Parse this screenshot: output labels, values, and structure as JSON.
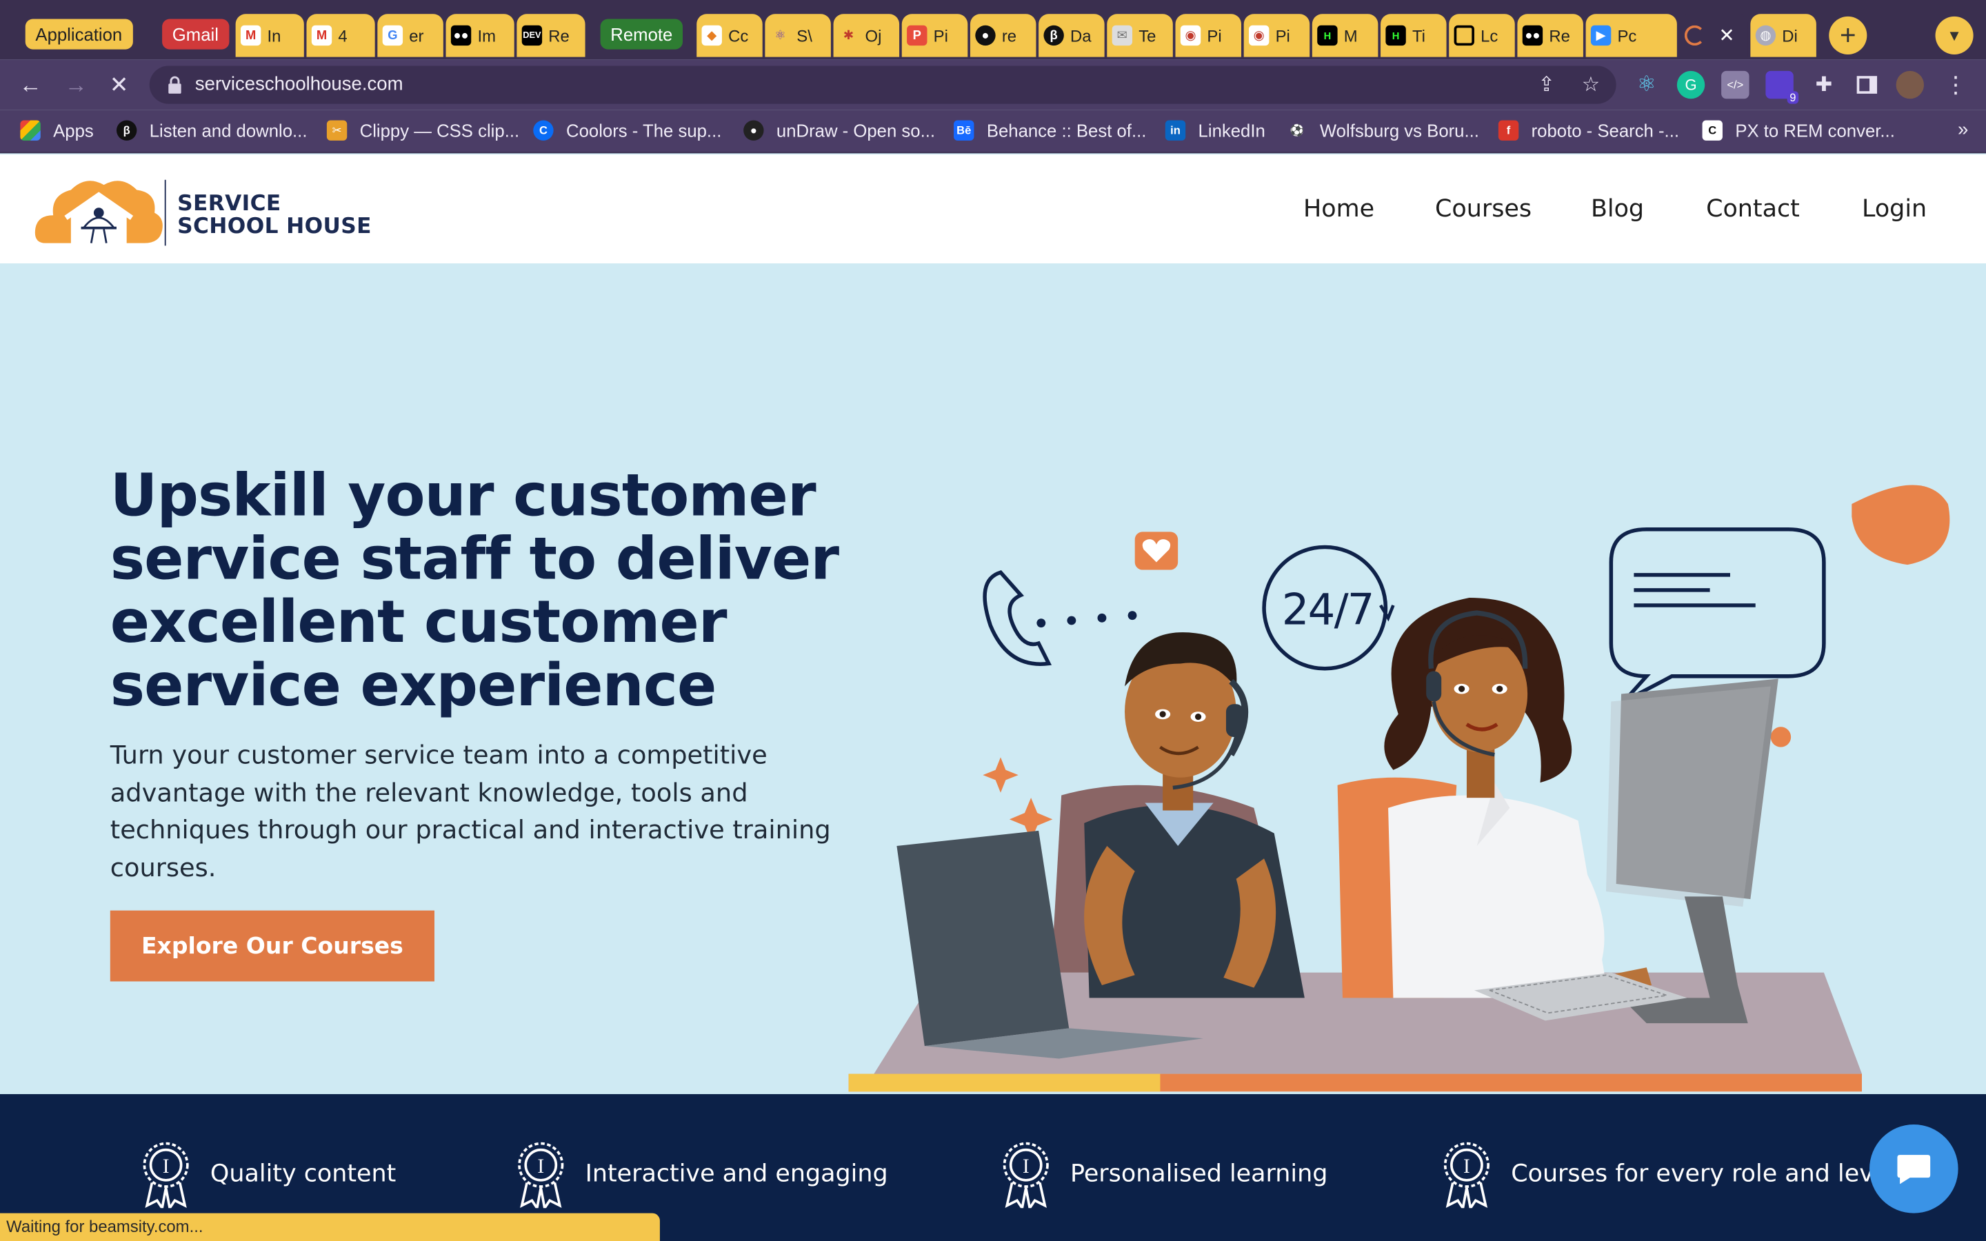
{
  "browser": {
    "tab_groups": {
      "application": "Application",
      "gmail": "Gmail",
      "remote": "Remote"
    },
    "tabs": [
      {
        "label": "In",
        "icon": "gmail-icon"
      },
      {
        "label": "4",
        "icon": "gmail-icon"
      },
      {
        "label": "er",
        "icon": "google-icon"
      },
      {
        "label": "Im",
        "icon": "medium-icon"
      },
      {
        "label": "Re",
        "icon": "dev-icon"
      },
      {
        "label": "Cc",
        "icon": "codepen-icon"
      },
      {
        "label": "S\\",
        "icon": "atom-icon"
      },
      {
        "label": "Oj",
        "icon": "react-icon"
      },
      {
        "label": "Pi",
        "icon": "pinterest-icon"
      },
      {
        "label": "re",
        "icon": "github-icon"
      },
      {
        "label": "Da",
        "icon": "beamsity-icon"
      },
      {
        "label": "Te",
        "icon": "mail-icon"
      },
      {
        "label": "Pi",
        "icon": "owl-icon"
      },
      {
        "label": "Pi",
        "icon": "owl-icon"
      },
      {
        "label": "M",
        "icon": "hackernoon-icon"
      },
      {
        "label": "Ti",
        "icon": "hackernoon-icon"
      },
      {
        "label": "Lc",
        "icon": "square-icon"
      },
      {
        "label": "Re",
        "icon": "medium-icon"
      },
      {
        "label": "Pc",
        "icon": "zoom-icon"
      },
      {
        "label": "",
        "icon": "loading-icon"
      },
      {
        "label": "Di",
        "icon": "globe-icon"
      }
    ],
    "url": "serviceschoolhouse.com",
    "extension_badge": "9",
    "bookmarks": [
      {
        "label": "Apps",
        "icon": "apps-grid-icon"
      },
      {
        "label": "Listen and downlo...",
        "icon": "beamsity-icon"
      },
      {
        "label": "Clippy — CSS clip...",
        "icon": "clippy-icon"
      },
      {
        "label": "Coolors - The sup...",
        "icon": "coolors-icon"
      },
      {
        "label": "unDraw - Open so...",
        "icon": "undraw-icon"
      },
      {
        "label": "Behance :: Best of...",
        "icon": "behance-icon"
      },
      {
        "label": "LinkedIn",
        "icon": "linkedin-icon"
      },
      {
        "label": "Wolfsburg vs Boru...",
        "icon": "soccer-icon"
      },
      {
        "label": "roboto - Search -...",
        "icon": "fonts-icon"
      },
      {
        "label": "PX to REM conver...",
        "icon": "converter-icon"
      }
    ],
    "status_text": "Waiting for beamsity.com..."
  },
  "site": {
    "logo": {
      "line1": "SERVICE",
      "line2": "SCHOOL HOUSE"
    },
    "nav": [
      "Home",
      "Courses",
      "Blog",
      "Contact",
      "Login"
    ],
    "hero": {
      "title": "Upskill your customer service staff to deliver excellent customer service experience",
      "subtitle": "Turn your customer service team into a competitive advantage with the relevant knowledge, tools and techniques through our practical and interactive training courses.",
      "cta": "Explore Our Courses",
      "badge_text": "24/7"
    },
    "features": [
      "Quality content",
      "Interactive and engaging",
      "Personalised learning",
      "Courses for every role and level"
    ]
  },
  "colors": {
    "tab_yellow": "#f4c64c",
    "browser_purple": "#4b3d66",
    "hero_bg": "#cfeaf3",
    "navy": "#0c2148",
    "accent_orange": "#e07a45",
    "chat_blue": "#3a93e6"
  }
}
